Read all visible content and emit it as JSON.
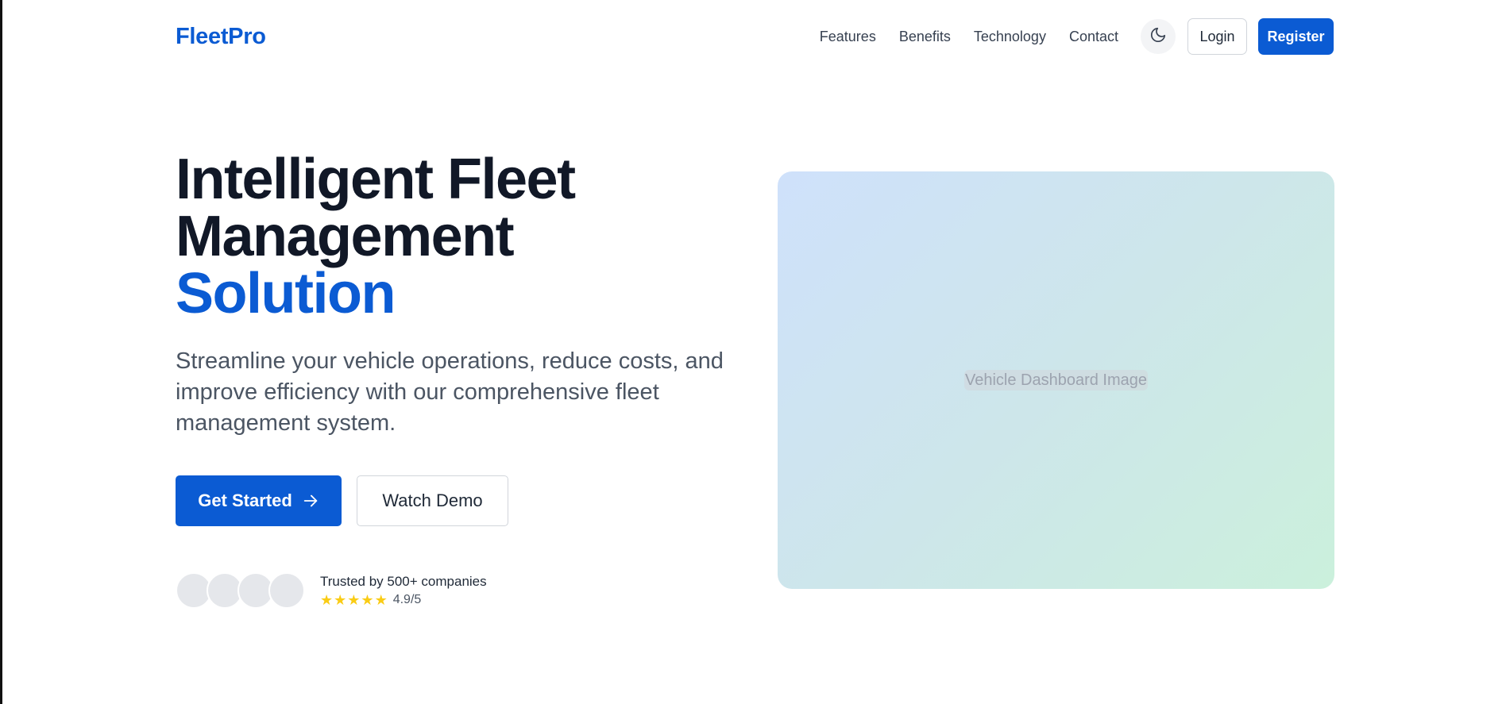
{
  "header": {
    "logo": "FleetPro",
    "nav": [
      "Features",
      "Benefits",
      "Technology",
      "Contact"
    ],
    "theme_icon": "moon-icon",
    "login_label": "Login",
    "register_label": "Register"
  },
  "hero": {
    "title_line1": "Intelligent Fleet",
    "title_line2": "Management",
    "title_line3": "Solution",
    "subtitle": "Streamline your vehicle operations, reduce costs, and improve efficiency with our comprehensive fleet management system.",
    "primary_cta": "Get Started",
    "primary_cta_icon": "arrow-right-icon",
    "secondary_cta": "Watch Demo",
    "trust_text": "Trusted by 500+ companies",
    "rating": "4.9/5",
    "stars": 5
  },
  "dashboard": {
    "placeholder": "Vehicle Dashboard Image"
  },
  "colors": {
    "brand": "#0b5bd3",
    "heading": "#111827",
    "body_text": "#4b5563",
    "star": "#facc15",
    "gradient_start": "#cfe1fb",
    "gradient_end": "#cbf0dc"
  }
}
